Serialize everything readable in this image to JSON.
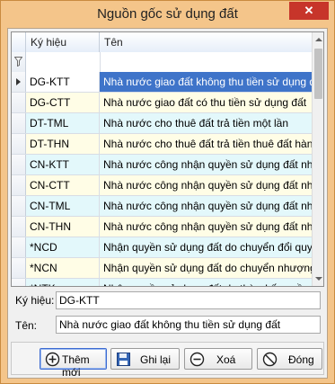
{
  "window": {
    "title": "Nguồn gốc sử dụng đất",
    "close_glyph": "✕"
  },
  "grid": {
    "columns": [
      "Ký hiệu",
      "Tên"
    ],
    "rows": [
      {
        "code": "DG-KTT",
        "name": "Nhà nước giao đất không thu tiền sử dụng đất"
      },
      {
        "code": "DG-CTT",
        "name": "Nhà nước giao đất có thu tiền sử dụng đất"
      },
      {
        "code": "DT-TML",
        "name": "Nhà nước cho thuê đất trả tiền một lần"
      },
      {
        "code": "DT-THN",
        "name": "Nhà nước cho thuê đất trả tiền thuê đất hàng ..."
      },
      {
        "code": "CN-KTT",
        "name": "Nhà nước công nhận quyền sử dụng đất như N..."
      },
      {
        "code": "CN-CTT",
        "name": "Nhà nước công nhận quyền sử dụng đất như N..."
      },
      {
        "code": "CN-TML",
        "name": "Nhà nước công nhận quyền sử dụng đất như N..."
      },
      {
        "code": "CN-THN",
        "name": "Nhà nước công nhận quyền sử dụng đất như N..."
      },
      {
        "code": "*NCD",
        "name": "Nhận quyền sử dụng đất do chuyển đổi quyền ..."
      },
      {
        "code": "*NCN",
        "name": "Nhận quyền sử dụng đất do chuyển nhượng q..."
      },
      {
        "code": "*NTK",
        "name": "Nhận quyền sử dụng đất do thừa kế quyền sử ..."
      },
      {
        "code": "",
        "name": ""
      }
    ]
  },
  "form": {
    "code_label": "Ký hiệu:",
    "code_value": "DG-KTT",
    "name_label": "Tên:",
    "name_value": "Nhà nước giao đất không thu tiền sử dụng đất"
  },
  "buttons": {
    "add": "Thêm mới",
    "save": "Ghi lại",
    "delete": "Xoá",
    "close": "Đóng"
  },
  "icons": {
    "add": "plus-circle-icon",
    "save": "floppy-disk-icon",
    "delete": "minus-circle-icon",
    "close": "no-entry-icon",
    "filter": "funnel-icon",
    "current_row": "row-arrow-icon"
  },
  "colors": {
    "title_bar": "#f4c58a",
    "selected_row": "#3f74c9",
    "row_even": "#e3f8fb",
    "row_odd": "#fffde6",
    "close_button": "#c7352a"
  }
}
